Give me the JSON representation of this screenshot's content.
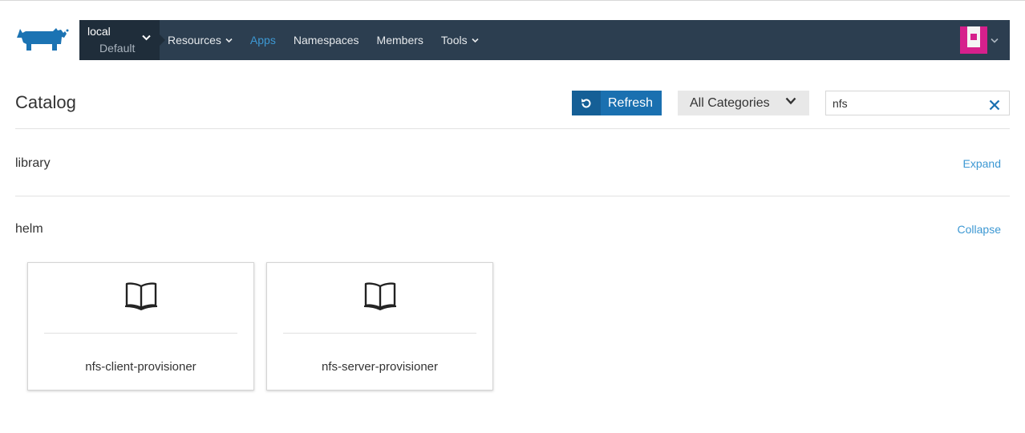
{
  "header": {
    "logo_icon": "rancher-cow-logo",
    "cluster": {
      "name": "local",
      "project": "Default"
    },
    "nav": [
      {
        "label": "Resources",
        "has_dropdown": true,
        "active": false
      },
      {
        "label": "Apps",
        "has_dropdown": false,
        "active": true
      },
      {
        "label": "Namespaces",
        "has_dropdown": false,
        "active": false
      },
      {
        "label": "Members",
        "has_dropdown": false,
        "active": false
      },
      {
        "label": "Tools",
        "has_dropdown": true,
        "active": false
      }
    ],
    "user_avatar_icon": "user-avatar-identicon"
  },
  "main": {
    "title": "Catalog",
    "refresh_label": "Refresh",
    "category_select": {
      "selected": "All Categories"
    },
    "search": {
      "value": "nfs",
      "placeholder": ""
    },
    "groups": [
      {
        "name": "library",
        "action": "Expand",
        "items": []
      },
      {
        "name": "helm",
        "action": "Collapse",
        "items": [
          {
            "title": "nfs-client-provisioner",
            "icon": "book-icon"
          },
          {
            "title": "nfs-server-provisioner",
            "icon": "book-icon"
          }
        ]
      }
    ]
  },
  "colors": {
    "navbar": "#2c3e50",
    "cluster_bg": "#1f2d3a",
    "accent": "#3d98d3",
    "refresh_button": "#1a70b0",
    "logo": "#1b73b3",
    "avatar": "#d6208c"
  }
}
